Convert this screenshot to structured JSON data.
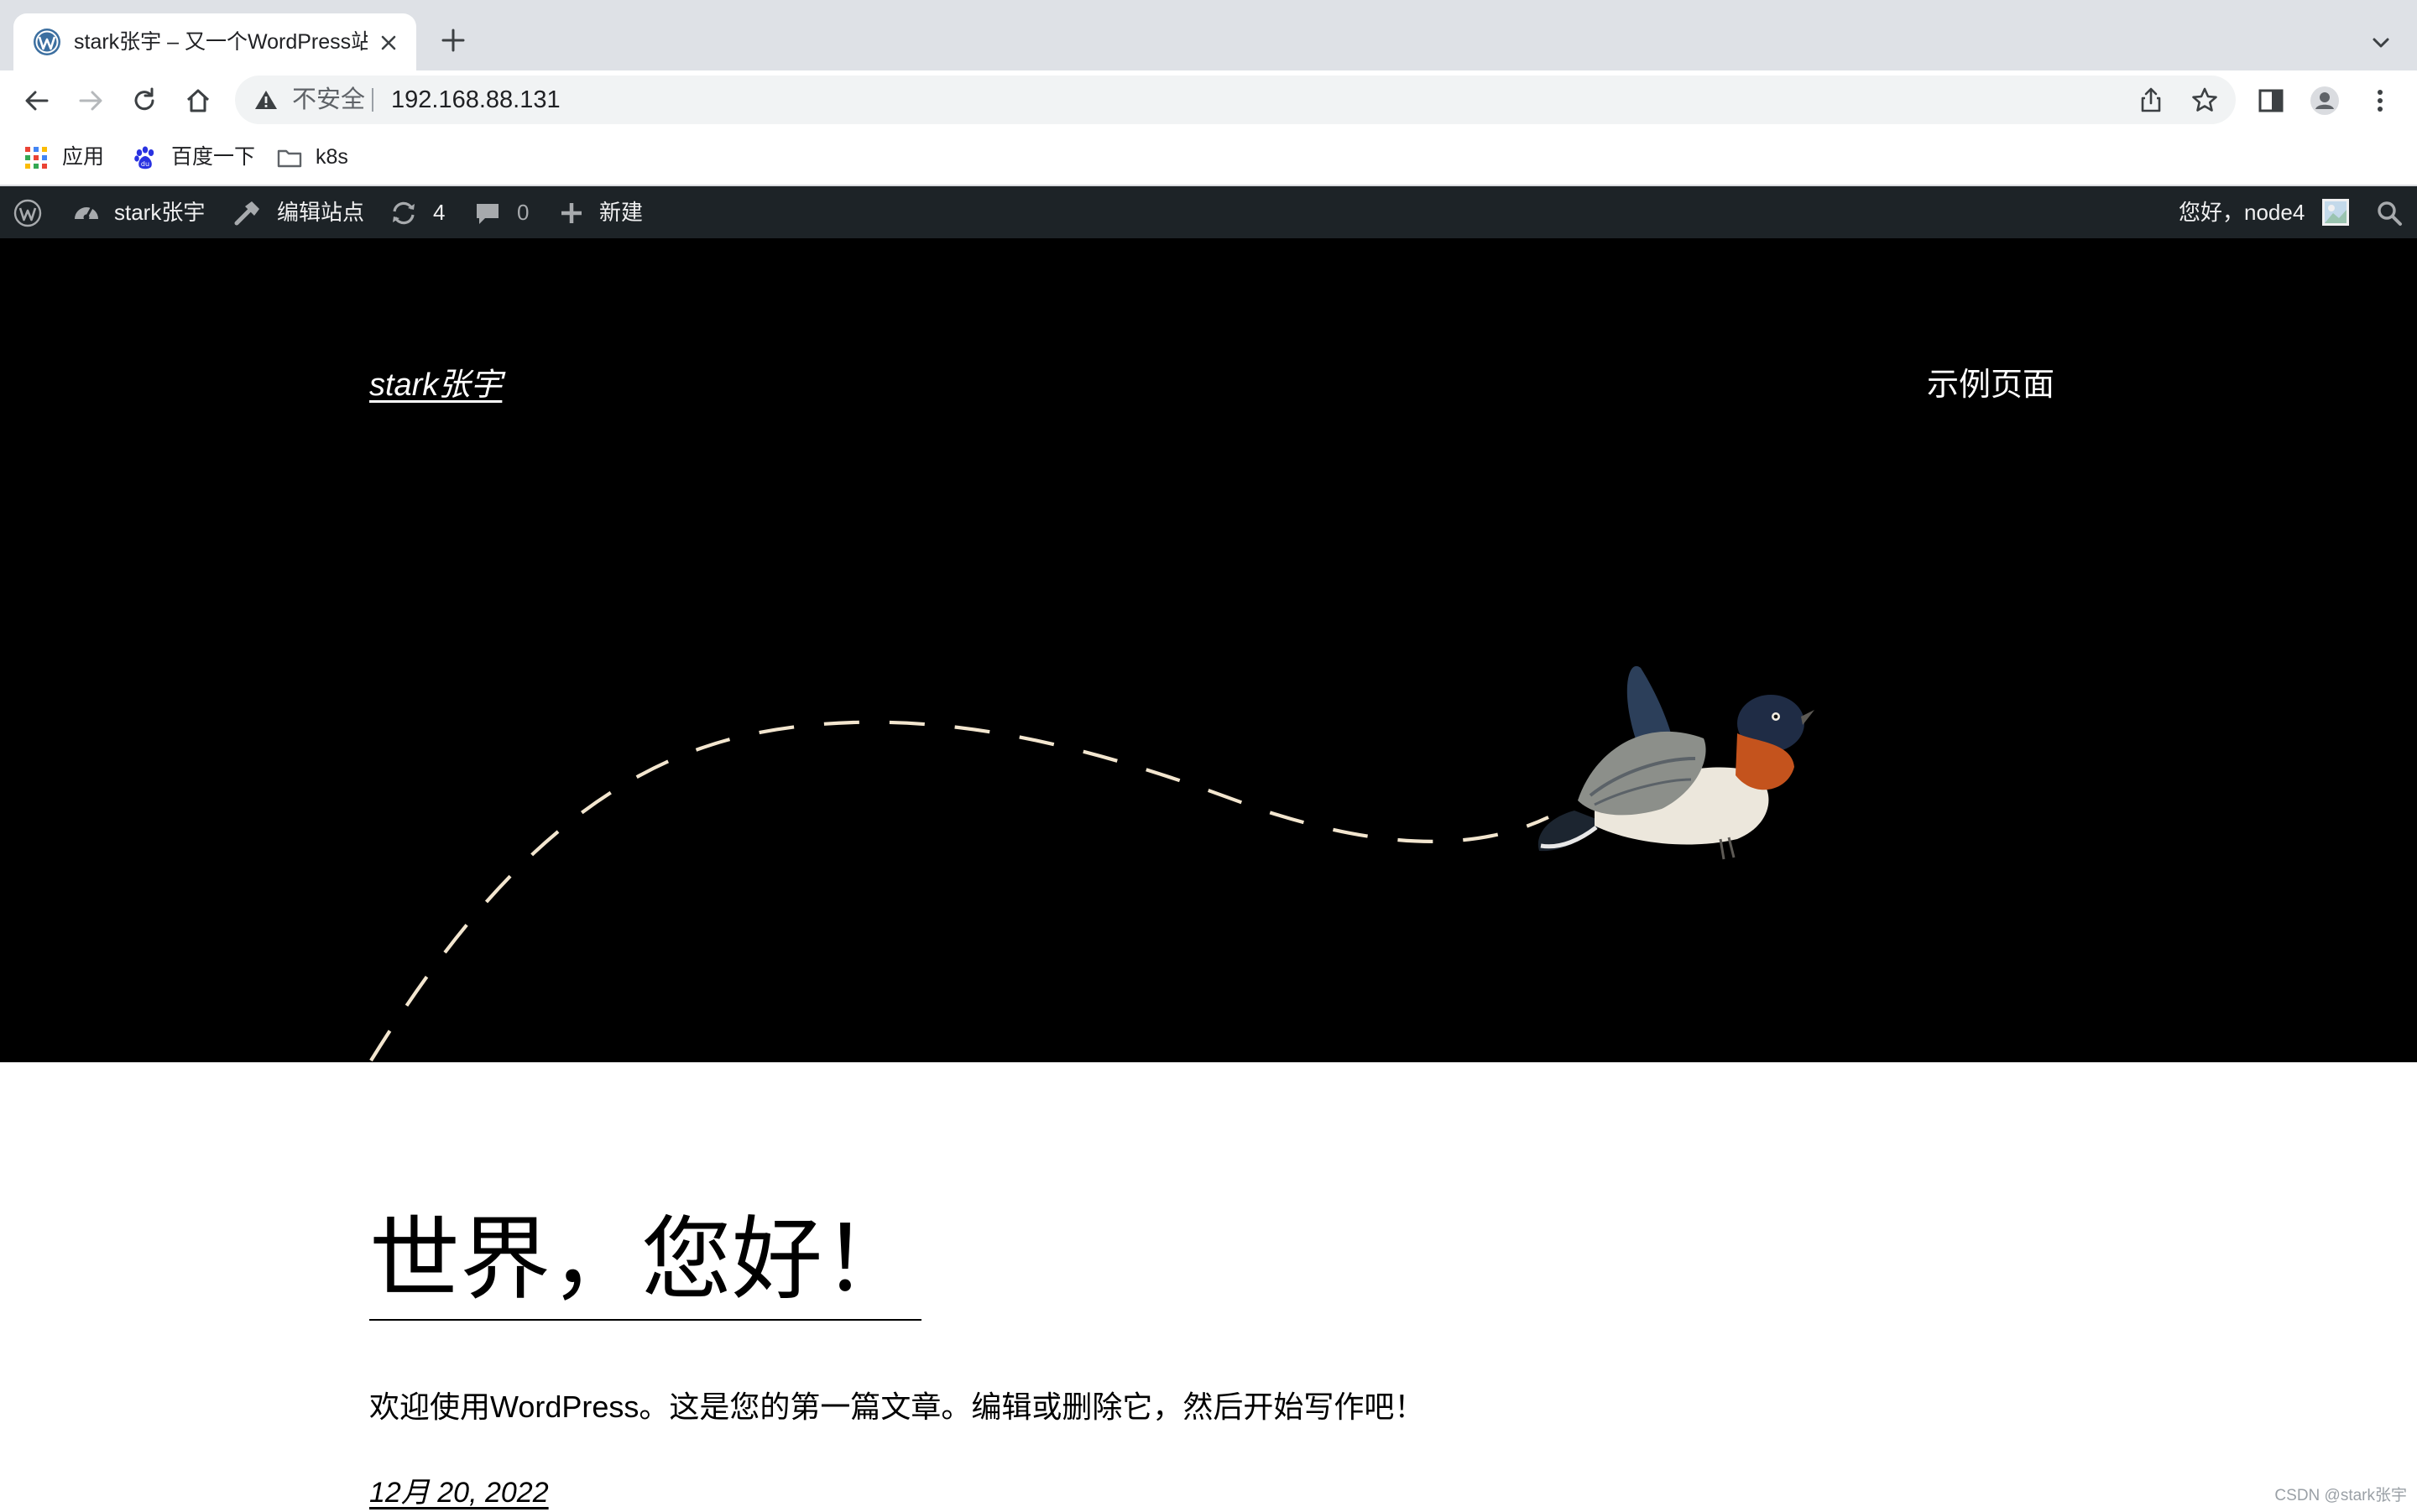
{
  "browser": {
    "tab_title": "stark张宇 – 又一个WordPress站",
    "omnibox": {
      "security_label": "不安全",
      "url": "192.168.88.131"
    },
    "bookmarks": [
      {
        "label": "应用",
        "icon": "apps-grid-icon"
      },
      {
        "label": "百度一下",
        "icon": "baidu-paw-icon"
      },
      {
        "label": "k8s",
        "icon": "folder-icon"
      }
    ]
  },
  "admin_bar": {
    "site_name": "stark张宇",
    "edit_site": "编辑站点",
    "updates_count": "4",
    "comments_count": "0",
    "new_label": "新建",
    "greeting": "您好，node4"
  },
  "site": {
    "title": "stark张宇",
    "nav_item": "示例页面"
  },
  "post": {
    "title": "世界，您好！",
    "excerpt": "欢迎使用WordPress。这是您的第一篇文章。编辑或删除它，然后开始写作吧！",
    "date": "12月 20, 2022"
  },
  "watermark": "CSDN @stark张宇",
  "colors": {
    "admin_bar_bg": "#1d2327",
    "hero_bg": "#000000",
    "tabstrip_bg": "#dee1e6",
    "dashed_path": "#f3e6cf"
  }
}
